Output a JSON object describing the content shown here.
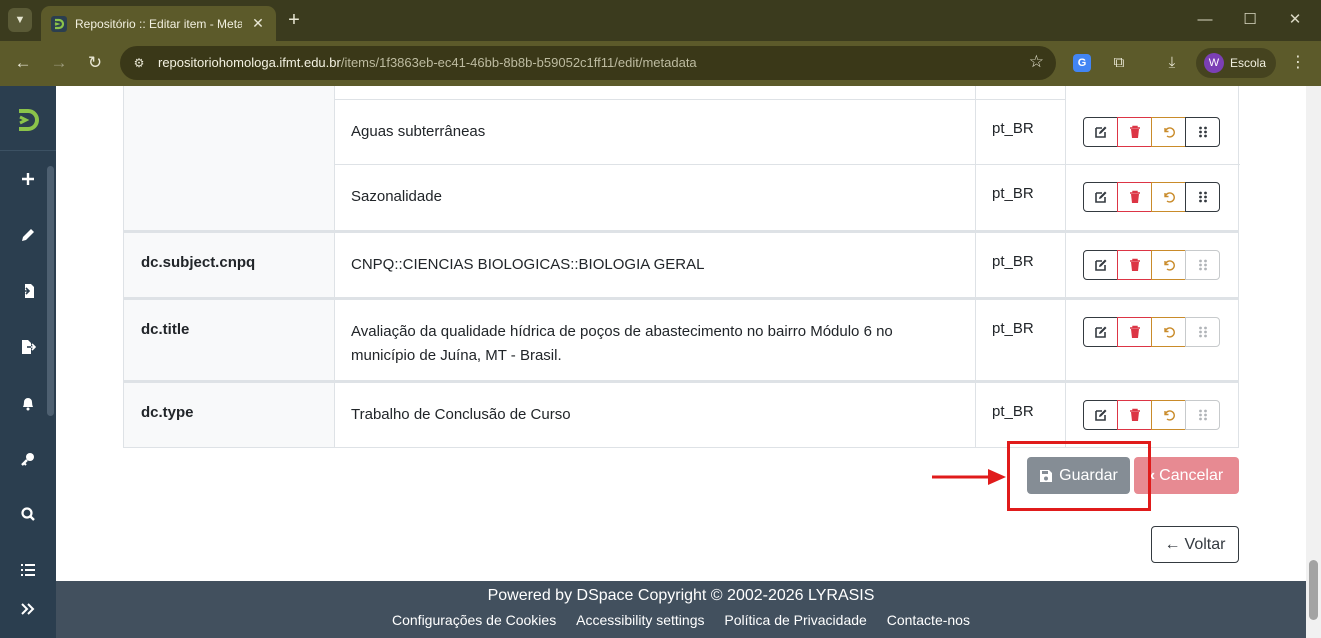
{
  "browser": {
    "tab_title": "Repositório :: Editar item - Metadata",
    "url_host": "repositoriohomologa.ifmt.edu.br",
    "url_path": "/items/1f3863eb-ec41-46bb-8b8b-b59052c1ff11/edit/metadata",
    "profile_initial": "W",
    "profile_name": "Escola"
  },
  "rows": [
    {
      "field": "",
      "value": "Aguas subterrâneas",
      "lang": "pt_BR"
    },
    {
      "field": "",
      "value": "Sazonalidade",
      "lang": "pt_BR"
    },
    {
      "field": "dc.subject.cnpq",
      "value": "CNPQ::CIENCIAS BIOLOGICAS::BIOLOGIA GERAL",
      "lang": "pt_BR"
    },
    {
      "field": "dc.title",
      "value": "Avaliação da qualidade hídrica de poços de abastecimento no bairro Módulo 6 no município de Juína, MT - Brasil.",
      "lang": "pt_BR"
    },
    {
      "field": "dc.type",
      "value": "Trabalho de Conclusão de Curso",
      "lang": "pt_BR"
    }
  ],
  "actions": {
    "save": "Guardar",
    "cancel": "Cancelar",
    "back": "Voltar"
  },
  "footer": {
    "powered": "Powered by DSpace Copyright © 2002-2026 LYRASIS",
    "links": [
      "Configurações de Cookies",
      "Accessibility settings",
      "Política de Privacidade",
      "Contacte-nos"
    ]
  },
  "colors": {
    "sidebar": "#2b3e4f",
    "footer": "#42505e",
    "danger": "#dc3545",
    "warning": "#c98b2a",
    "highlight": "#e01b1b"
  }
}
